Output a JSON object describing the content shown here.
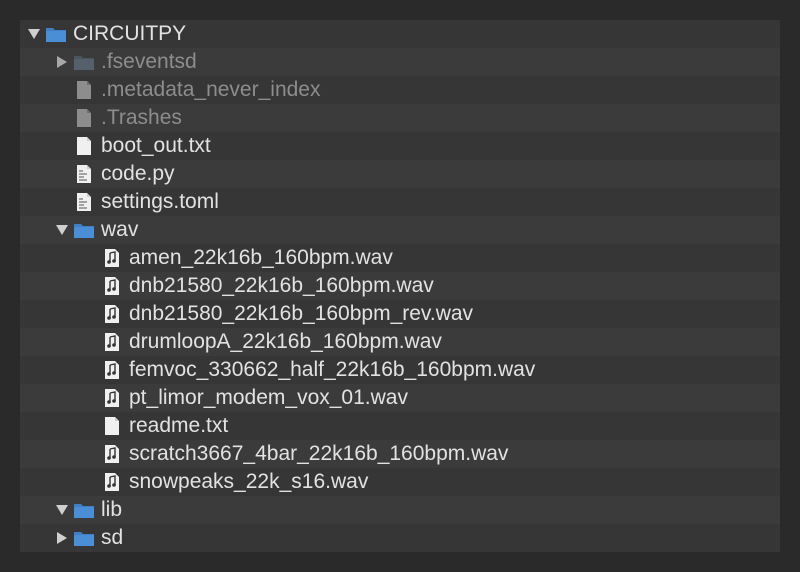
{
  "tree": {
    "items": [
      {
        "label": "CIRCUITPY",
        "icon": "folder-icon",
        "level": 0,
        "expand": "expanded",
        "dim": false
      },
      {
        "label": ".fseventsd",
        "icon": "folder-icon",
        "level": 1,
        "expand": "collapsed",
        "dim": true
      },
      {
        "label": ".metadata_never_index",
        "icon": "file-icon",
        "level": 1,
        "expand": "none",
        "dim": true
      },
      {
        "label": ".Trashes",
        "icon": "file-icon",
        "level": 1,
        "expand": "none",
        "dim": true
      },
      {
        "label": "boot_out.txt",
        "icon": "text-file-icon",
        "level": 1,
        "expand": "none",
        "dim": false
      },
      {
        "label": "code.py",
        "icon": "code-file-icon",
        "level": 1,
        "expand": "none",
        "dim": false
      },
      {
        "label": "settings.toml",
        "icon": "code-file-icon",
        "level": 1,
        "expand": "none",
        "dim": false
      },
      {
        "label": "wav",
        "icon": "folder-icon",
        "level": 1,
        "expand": "expanded",
        "dim": false
      },
      {
        "label": "amen_22k16b_160bpm.wav",
        "icon": "audio-file-icon",
        "level": 2,
        "expand": "none",
        "dim": false
      },
      {
        "label": "dnb21580_22k16b_160bpm.wav",
        "icon": "audio-file-icon",
        "level": 2,
        "expand": "none",
        "dim": false
      },
      {
        "label": "dnb21580_22k16b_160bpm_rev.wav",
        "icon": "audio-file-icon",
        "level": 2,
        "expand": "none",
        "dim": false
      },
      {
        "label": "drumloopA_22k16b_160bpm.wav",
        "icon": "audio-file-icon",
        "level": 2,
        "expand": "none",
        "dim": false
      },
      {
        "label": "femvoc_330662_half_22k16b_160bpm.wav",
        "icon": "audio-file-icon",
        "level": 2,
        "expand": "none",
        "dim": false
      },
      {
        "label": "pt_limor_modem_vox_01.wav",
        "icon": "audio-file-icon",
        "level": 2,
        "expand": "none",
        "dim": false
      },
      {
        "label": "readme.txt",
        "icon": "text-file-icon",
        "level": 2,
        "expand": "none",
        "dim": false
      },
      {
        "label": "scratch3667_4bar_22k16b_160bpm.wav",
        "icon": "audio-file-icon",
        "level": 2,
        "expand": "none",
        "dim": false
      },
      {
        "label": "snowpeaks_22k_s16.wav",
        "icon": "audio-file-icon",
        "level": 2,
        "expand": "none",
        "dim": false
      },
      {
        "label": "lib",
        "icon": "folder-icon",
        "level": 1,
        "expand": "expanded",
        "dim": false
      },
      {
        "label": "sd",
        "icon": "folder-icon",
        "level": 1,
        "expand": "collapsed",
        "dim": false
      }
    ]
  },
  "colors": {
    "folder": "#4a8fd6",
    "file": "#f0f0f0",
    "file_dim": "#8d8d8d"
  }
}
